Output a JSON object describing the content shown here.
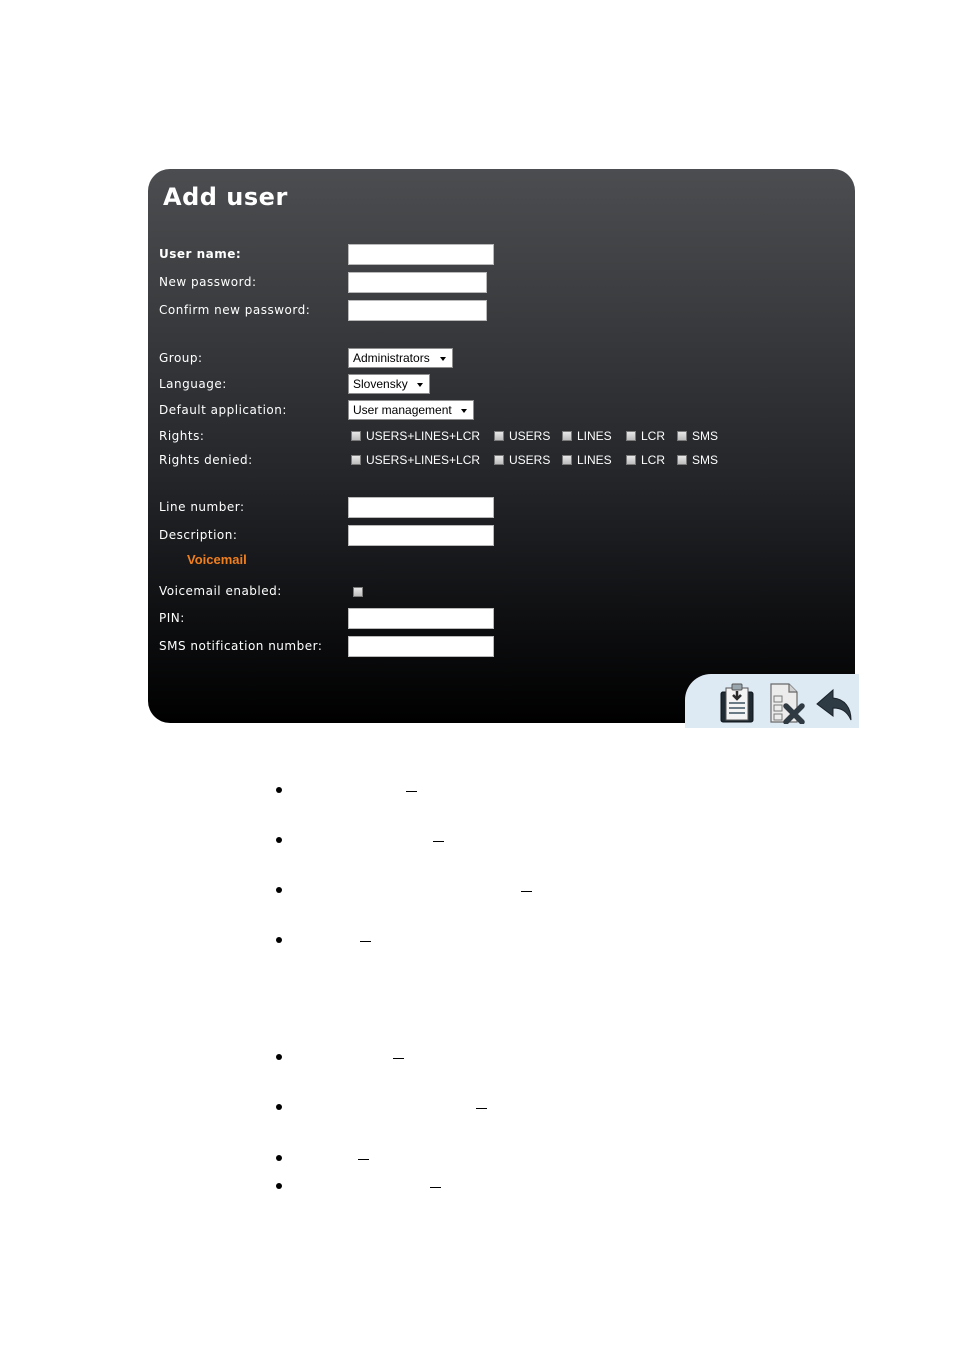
{
  "form": {
    "title": "Add user",
    "fields": {
      "user_name": "User name:",
      "new_password": "New password:",
      "confirm_password": "Confirm new password:",
      "group": "Group:",
      "language": "Language:",
      "default_application": "Default application:",
      "rights": "Rights:",
      "rights_denied": "Rights denied:",
      "line_number": "Line number:",
      "description": "Description:",
      "voicemail_section": "Voicemail",
      "voicemail_enabled": "Voicemail enabled:",
      "pin": "PIN:",
      "sms_notification_number": "SMS notification number:"
    },
    "values": {
      "user_name": "",
      "new_password": "",
      "confirm_password": "",
      "group": "Administrators",
      "language": "Slovensky",
      "default_application": "User management",
      "line_number": "",
      "description": "",
      "pin": "",
      "sms_notification_number": ""
    },
    "rights_options": [
      "USERS+LINES+LCR",
      "USERS",
      "LINES",
      "LCR",
      "SMS"
    ],
    "rights_checked": [
      false,
      false,
      false,
      false,
      false
    ],
    "rights_denied_checked": [
      false,
      false,
      false,
      false,
      false
    ],
    "voicemail_enabled_checked": false
  },
  "toolbar": {
    "buttons": [
      {
        "icon": "save-document-icon"
      },
      {
        "icon": "cancel-document-icon"
      },
      {
        "icon": "back-arrow-icon"
      }
    ]
  },
  "document": {
    "bullet_dash": "–"
  }
}
